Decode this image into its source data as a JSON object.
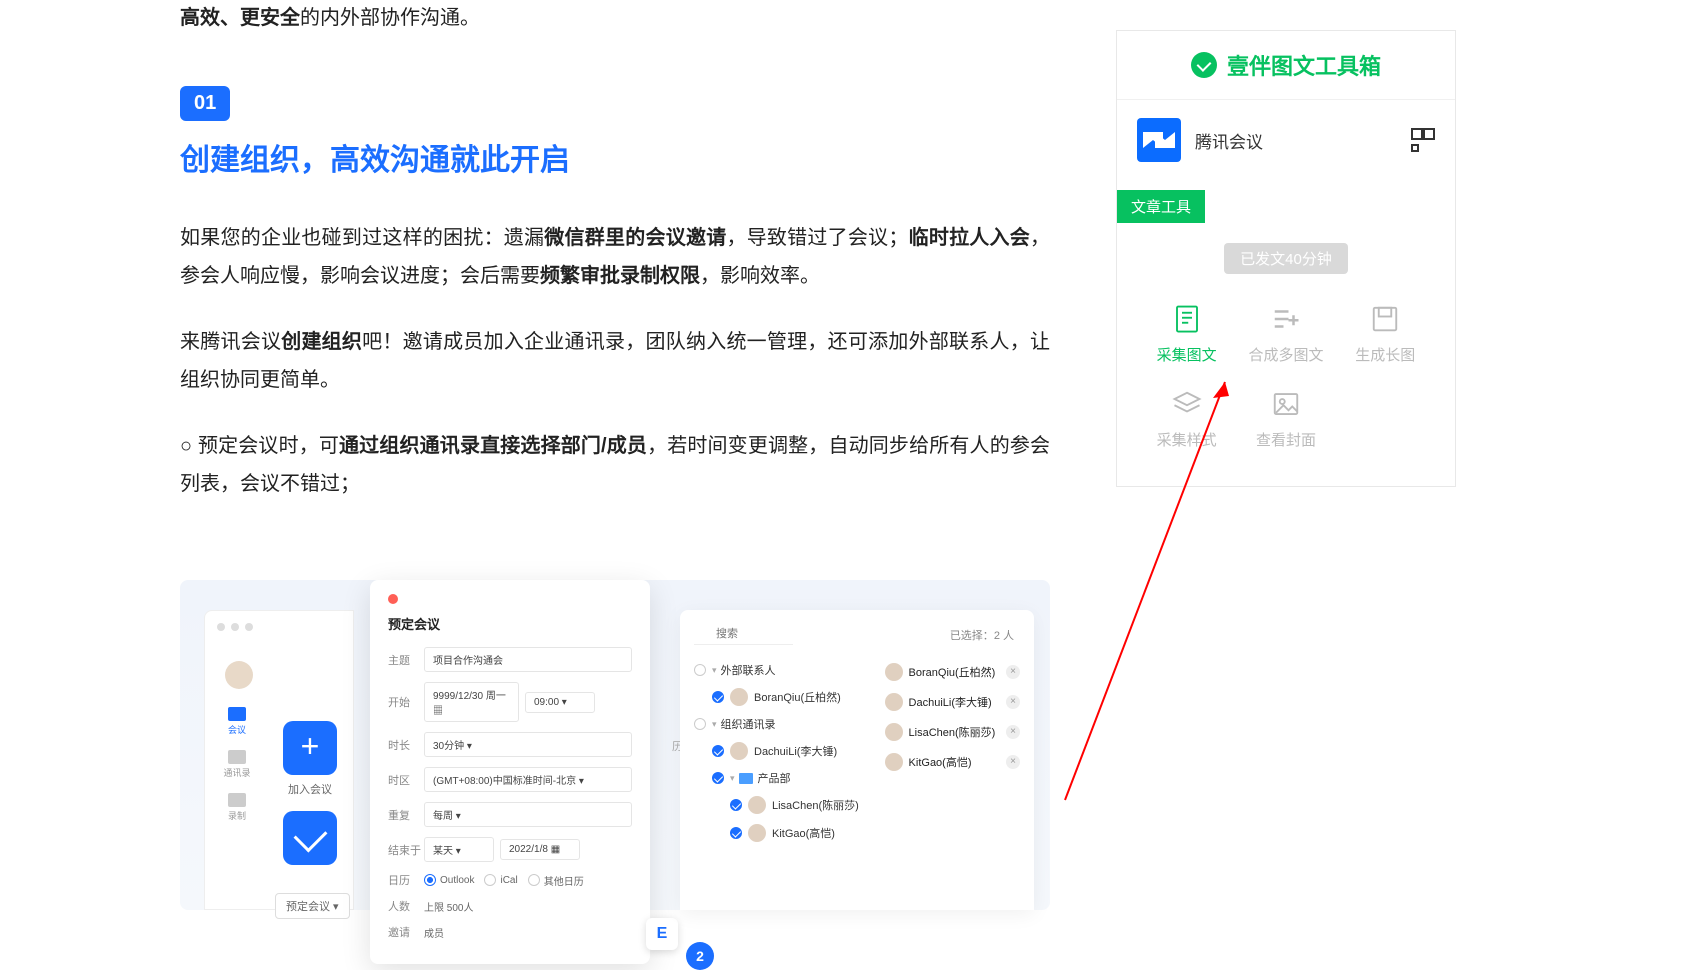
{
  "intro": {
    "bold": "高效、更安全",
    "rest": "的内外部协作沟通。"
  },
  "section": {
    "num": "01",
    "title": "创建组织，高效沟通就此开启"
  },
  "p1": {
    "t1": "如果您的企业也碰到过这样的困扰：遗漏",
    "b1": "微信群里的会议邀请",
    "t2": "，导致错过了会议；",
    "b2": "临时拉人入会",
    "t3": "，参会人响应慢，影响会议进度；会后需要",
    "b3": "频繁审批录制权限",
    "t4": "，影响效率。"
  },
  "p2": {
    "t1": "来腾讯会议",
    "b1": "创建组织",
    "t2": "吧！邀请成员加入企业通讯录，团队纳入统一管理，还可添加外部联系人，让组织协同更简单。"
  },
  "p3": {
    "t1": "○ 预定会议时，可",
    "b1": "通过组织通讯录直接选择部门/成员",
    "t2": "，若时间变更调整，自动同步给所有人的参会列表，会议不错过；"
  },
  "leftpane": {
    "tab1": "会议",
    "tab2": "通讯录",
    "tab3": "录制",
    "join": "加入会议",
    "dropdown": "预定会议 ▾"
  },
  "history": "历史会议 >",
  "sched": {
    "title": "预定会议",
    "rows": {
      "topic_lbl": "主题",
      "topic_val": "项目合作沟通会",
      "start_lbl": "开始",
      "start_date": "9999/12/30 周一 ▦",
      "start_time": "09:00 ▾",
      "dur_lbl": "时长",
      "dur_val": "30分钟 ▾",
      "tz_lbl": "时区",
      "tz_val": "(GMT+08:00)中国标准时间-北京 ▾",
      "rep_lbl": "重复",
      "rep_val": "每周 ▾",
      "end_lbl": "结束于",
      "end_sel": "某天 ▾",
      "end_date": "2022/1/8 ▦",
      "cal_lbl": "日历",
      "cal1": "Outlook",
      "cal2": "iCal",
      "cal3": "其他日历",
      "cap_lbl": "人数",
      "cap_val": "上限 500人",
      "inv_lbl": "邀请",
      "inv_val": "成员"
    },
    "badge": "2",
    "float": "E"
  },
  "selector": {
    "search": "搜索",
    "count_lbl": "已选择：",
    "count_val": "2 人",
    "tree": {
      "ext": "外部联系人",
      "p1": "BoranQiu(丘柏然)",
      "org": "组织通讯录",
      "p2": "DachuiLi(李大锤)",
      "dept": "产品部",
      "p3": "LisaChen(陈丽莎)",
      "p4": "KitGao(高恺)"
    },
    "picked": {
      "p1": "BoranQiu(丘柏然)",
      "p2": "DachuiLi(李大锤)",
      "p3": "LisaChen(陈丽莎)",
      "p4": "KitGao(高恺)"
    }
  },
  "sidebar": {
    "title": "壹伴图文工具箱",
    "org": "腾讯会议",
    "section": "文章工具",
    "time": "已发文40分钟",
    "tools": {
      "t1": "采集图文",
      "t2": "合成多图文",
      "t3": "生成长图",
      "t4": "采集样式",
      "t5": "查看封面"
    }
  }
}
